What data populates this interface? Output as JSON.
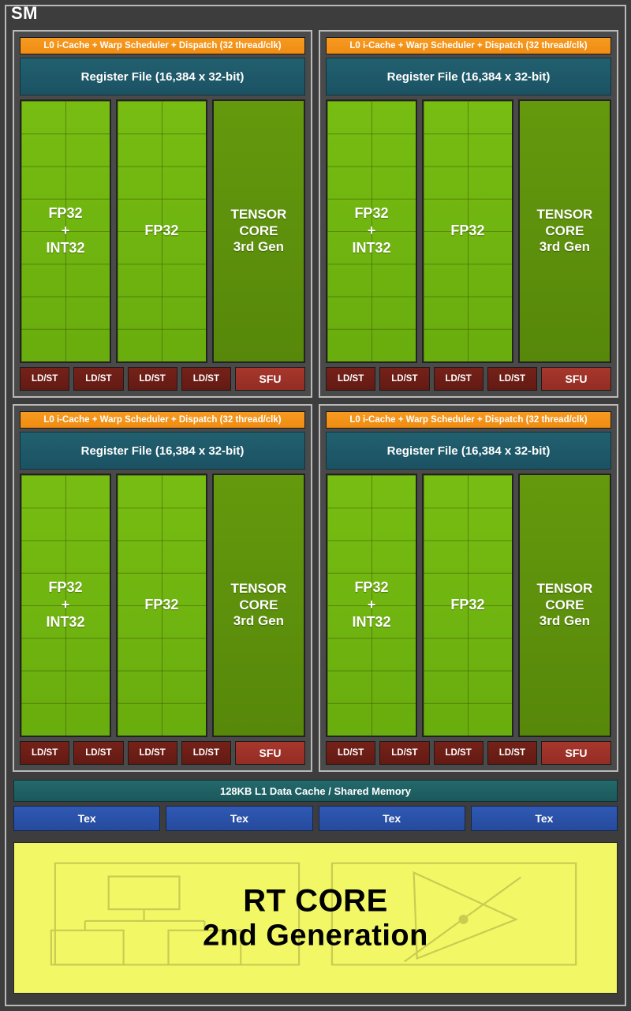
{
  "diagram": {
    "title": "SM",
    "subsystem_title_color": "#ffffff",
    "background_color": "#3d3d3d"
  },
  "colors": {
    "scheduler": "#f08c12",
    "register_file": "#1d5a6b",
    "fp32_core": "#6fb510",
    "tensor_core": "#5d920c",
    "ldst": "#6d1f17",
    "sfu": "#9c3228",
    "l1_cache": "#1f6063",
    "tex": "#2b53a8",
    "rt_core": "#f2f765",
    "frame_border": "#b9b9b9"
  },
  "processing_blocks": [
    {
      "id": "processing-block-0",
      "scheduler": "L0 i-Cache + Warp Scheduler + Dispatch (32 thread/clk)",
      "register_file": "Register File (16,384 x 32-bit)",
      "cores": [
        {
          "id": "fp32-int32",
          "label": "FP32\n+\nINT32",
          "type": "fp32-int32",
          "grid_cols": 2,
          "grid_rows": 8
        },
        {
          "id": "fp32",
          "label": "FP32",
          "type": "fp32",
          "grid_cols": 2,
          "grid_rows": 8
        },
        {
          "id": "tensor",
          "label": "TENSOR\nCORE\n3rd Gen",
          "type": "tensor",
          "grid_cols": 1,
          "grid_rows": 1
        }
      ],
      "ldst": [
        "LD/ST",
        "LD/ST",
        "LD/ST",
        "LD/ST"
      ],
      "sfu": "SFU"
    },
    {
      "id": "processing-block-1",
      "scheduler": "L0 i-Cache + Warp Scheduler + Dispatch (32 thread/clk)",
      "register_file": "Register File (16,384 x 32-bit)",
      "cores": [
        {
          "id": "fp32-int32",
          "label": "FP32\n+\nINT32",
          "type": "fp32-int32",
          "grid_cols": 2,
          "grid_rows": 8
        },
        {
          "id": "fp32",
          "label": "FP32",
          "type": "fp32",
          "grid_cols": 2,
          "grid_rows": 8
        },
        {
          "id": "tensor",
          "label": "TENSOR\nCORE\n3rd Gen",
          "type": "tensor",
          "grid_cols": 1,
          "grid_rows": 1
        }
      ],
      "ldst": [
        "LD/ST",
        "LD/ST",
        "LD/ST",
        "LD/ST"
      ],
      "sfu": "SFU"
    },
    {
      "id": "processing-block-2",
      "scheduler": "L0 i-Cache + Warp Scheduler + Dispatch (32 thread/clk)",
      "register_file": "Register File (16,384 x 32-bit)",
      "cores": [
        {
          "id": "fp32-int32",
          "label": "FP32\n+\nINT32",
          "type": "fp32-int32",
          "grid_cols": 2,
          "grid_rows": 8
        },
        {
          "id": "fp32",
          "label": "FP32",
          "type": "fp32",
          "grid_cols": 2,
          "grid_rows": 8
        },
        {
          "id": "tensor",
          "label": "TENSOR\nCORE\n3rd Gen",
          "type": "tensor",
          "grid_cols": 1,
          "grid_rows": 1
        }
      ],
      "ldst": [
        "LD/ST",
        "LD/ST",
        "LD/ST",
        "LD/ST"
      ],
      "sfu": "SFU"
    },
    {
      "id": "processing-block-3",
      "scheduler": "L0 i-Cache + Warp Scheduler + Dispatch (32 thread/clk)",
      "register_file": "Register File (16,384 x 32-bit)",
      "cores": [
        {
          "id": "fp32-int32",
          "label": "FP32\n+\nINT32",
          "type": "fp32-int32",
          "grid_cols": 2,
          "grid_rows": 8
        },
        {
          "id": "fp32",
          "label": "FP32",
          "type": "fp32",
          "grid_cols": 2,
          "grid_rows": 8
        },
        {
          "id": "tensor",
          "label": "TENSOR\nCORE\n3rd Gen",
          "type": "tensor",
          "grid_cols": 1,
          "grid_rows": 1
        }
      ],
      "ldst": [
        "LD/ST",
        "LD/ST",
        "LD/ST",
        "LD/ST"
      ],
      "sfu": "SFU"
    }
  ],
  "l1_cache": {
    "label": "128KB L1 Data Cache / Shared Memory"
  },
  "tex_units": [
    {
      "label": "Tex"
    },
    {
      "label": "Tex"
    },
    {
      "label": "Tex"
    },
    {
      "label": "Tex"
    }
  ],
  "rt_core": {
    "line1": "RT CORE",
    "line2": "2nd Generation",
    "art": {
      "left_panel": "bvh-tree-diagram",
      "right_panel": "ray-triangle-intersection-diagram"
    }
  }
}
